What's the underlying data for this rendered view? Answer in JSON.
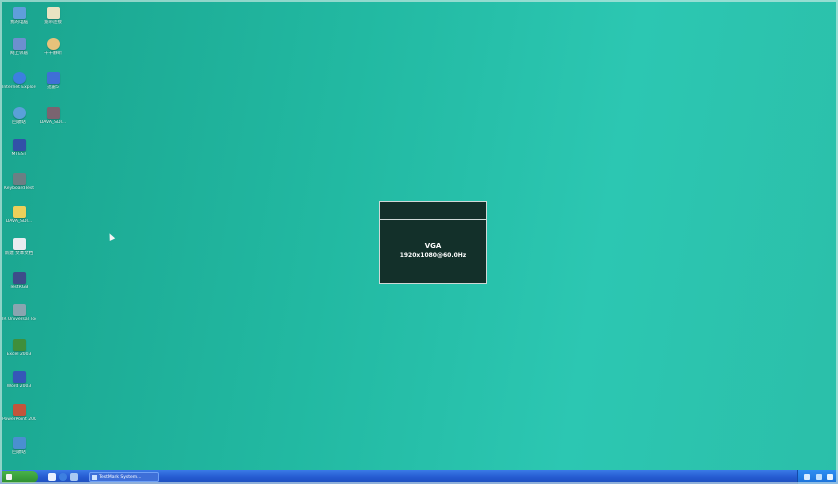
{
  "desktop": {
    "icons": [
      {
        "label": "我的电脑",
        "icon": "my-computer-icon",
        "color": "#5f9edb"
      },
      {
        "label": "宽带连接",
        "icon": "network-icon",
        "color": "#e9e4c2"
      },
      {
        "label": "网上邻居",
        "icon": "network-places-icon",
        "color": "#6d8fcf"
      },
      {
        "label": "千千静听",
        "icon": "music-player-icon",
        "color": "#e7c27b"
      },
      {
        "label": "Internet Explorer",
        "icon": "internet-explorer-icon",
        "color": "#3d7fe0"
      },
      {
        "label": "迅雷5",
        "icon": "thunder-icon",
        "color": "#3f6fd6"
      },
      {
        "label": "回收站",
        "icon": "recycle-bin-icon",
        "color": "#5aa0d9"
      },
      {
        "label": "DAVA_SDI...",
        "icon": "video-file-icon",
        "color": "#7a6470"
      },
      {
        "label": "MTEST",
        "icon": "monitor-test-icon",
        "color": "#3251a8"
      },
      {
        "label": "KeyboardTest",
        "icon": "keyboard-icon",
        "color": "#6b7f84"
      },
      {
        "label": "DAVA_SDI...",
        "icon": "folder-icon",
        "color": "#ecd05a"
      },
      {
        "label": "新建 文本文档",
        "icon": "text-file-icon",
        "color": "#e8ecf0"
      },
      {
        "label": "TestRGB",
        "icon": "rgb-test-icon",
        "color": "#3d4d8a"
      },
      {
        "label": "IR Universal Tool",
        "icon": "ir-tool-icon",
        "color": "#8aa5b0"
      },
      {
        "label": "Excel 2003",
        "icon": "excel-icon",
        "color": "#3f8f3a"
      },
      {
        "label": "Word 2003",
        "icon": "word-icon",
        "color": "#3557b8"
      },
      {
        "label": "PowerPoint 2003",
        "icon": "powerpoint-icon",
        "color": "#c2553b"
      },
      {
        "label": "回收站",
        "icon": "trash-icon",
        "color": "#4a8fd0"
      }
    ]
  },
  "osd": {
    "input": "VGA",
    "resolution": "1920x1080@60.0Hz",
    "background": "#13302a"
  },
  "taskbar": {
    "start_icon": "windows-start-icon",
    "task_label": "TestMark System..."
  },
  "colors": {
    "desktop": "#22b9a2",
    "taskbar": "#2459cf"
  }
}
